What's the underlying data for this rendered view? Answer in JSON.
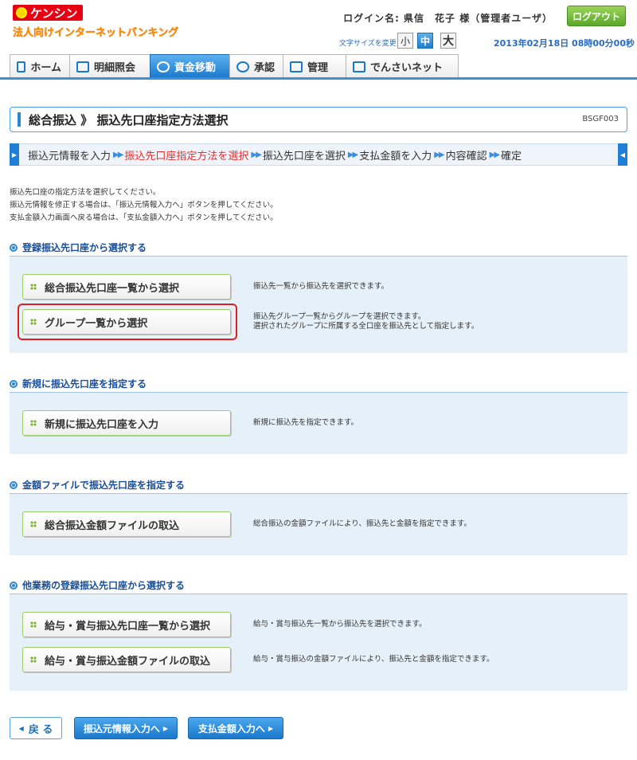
{
  "header": {
    "logo_text": "ケンシン",
    "logo_subtitle": "法人向けインターネットバンキング",
    "login_label": "ログイン名: 県信　花子 様（管理者ユーザ）",
    "logout_label": "ログアウト",
    "font_size_label": "文字サイズを変更",
    "font_sizes": [
      "小",
      "中",
      "大"
    ],
    "datetime": "2013年02月18日 08時00分00秒"
  },
  "nav": {
    "tabs": [
      {
        "label": "ホーム",
        "icon": "home-icon"
      },
      {
        "label": "明細照会",
        "icon": "document-icon"
      },
      {
        "label": "資金移動",
        "icon": "transfer-icon",
        "active": true
      },
      {
        "label": "承認",
        "icon": "check-icon"
      },
      {
        "label": "管理",
        "icon": "user-manage-icon"
      },
      {
        "label": "でんさいネット",
        "icon": "densai-icon"
      }
    ]
  },
  "page": {
    "title": "総合振込 》 振込先口座指定方法選択",
    "id": "BSGF003"
  },
  "steps": [
    {
      "label": "振込元情報を入力"
    },
    {
      "label": "振込先口座指定方法を選択",
      "current": true
    },
    {
      "label": "振込先口座を選択"
    },
    {
      "label": "支払金額を入力"
    },
    {
      "label": "内容確認"
    },
    {
      "label": "確定"
    }
  ],
  "instructions": [
    "振込先口座の指定方法を選択してください。",
    "振込元情報を修正する場合は、「振込元情報入力へ」ボタンを押してください。",
    "支払金額入力画面へ戻る場合は、「支払金額入力へ」ボタンを押してください。"
  ],
  "sections": [
    {
      "title": "登録振込先口座から選択する",
      "actions": [
        {
          "label": "総合振込先口座一覧から選択",
          "desc": [
            "振込先一覧から振込先を選択できます。"
          ]
        },
        {
          "label": "グループ一覧から選択",
          "desc": [
            "振込先グループ一覧からグループを選択できます。",
            "選択されたグループに所属する全口座を振込先として指定します。"
          ]
        }
      ]
    },
    {
      "title": "新規に振込先口座を指定する",
      "actions": [
        {
          "label": "新規に振込先口座を入力",
          "desc": [
            "新規に振込先を指定できます。"
          ]
        }
      ]
    },
    {
      "title": "金額ファイルで振込先口座を指定する",
      "actions": [
        {
          "label": "総合振込金額ファイルの取込",
          "desc": [
            "総合振込の金額ファイルにより、振込先と金額を指定できます。"
          ]
        }
      ]
    },
    {
      "title": "他業務の登録振込先口座から選択する",
      "actions": [
        {
          "label": "給与・賞与振込先口座一覧から選択",
          "desc": [
            "給与・賞与振込先一覧から振込先を選択できます。"
          ]
        },
        {
          "label": "給与・賞与振込金額ファイルの取込",
          "desc": [
            "給与・賞与振込の金額ファイルにより、振込先と金額を指定できます。"
          ]
        }
      ]
    }
  ],
  "footer": {
    "back_label": "戻 る",
    "prev_info_label": "振込元情報入力へ",
    "amount_label": "支払金額入力へ"
  }
}
